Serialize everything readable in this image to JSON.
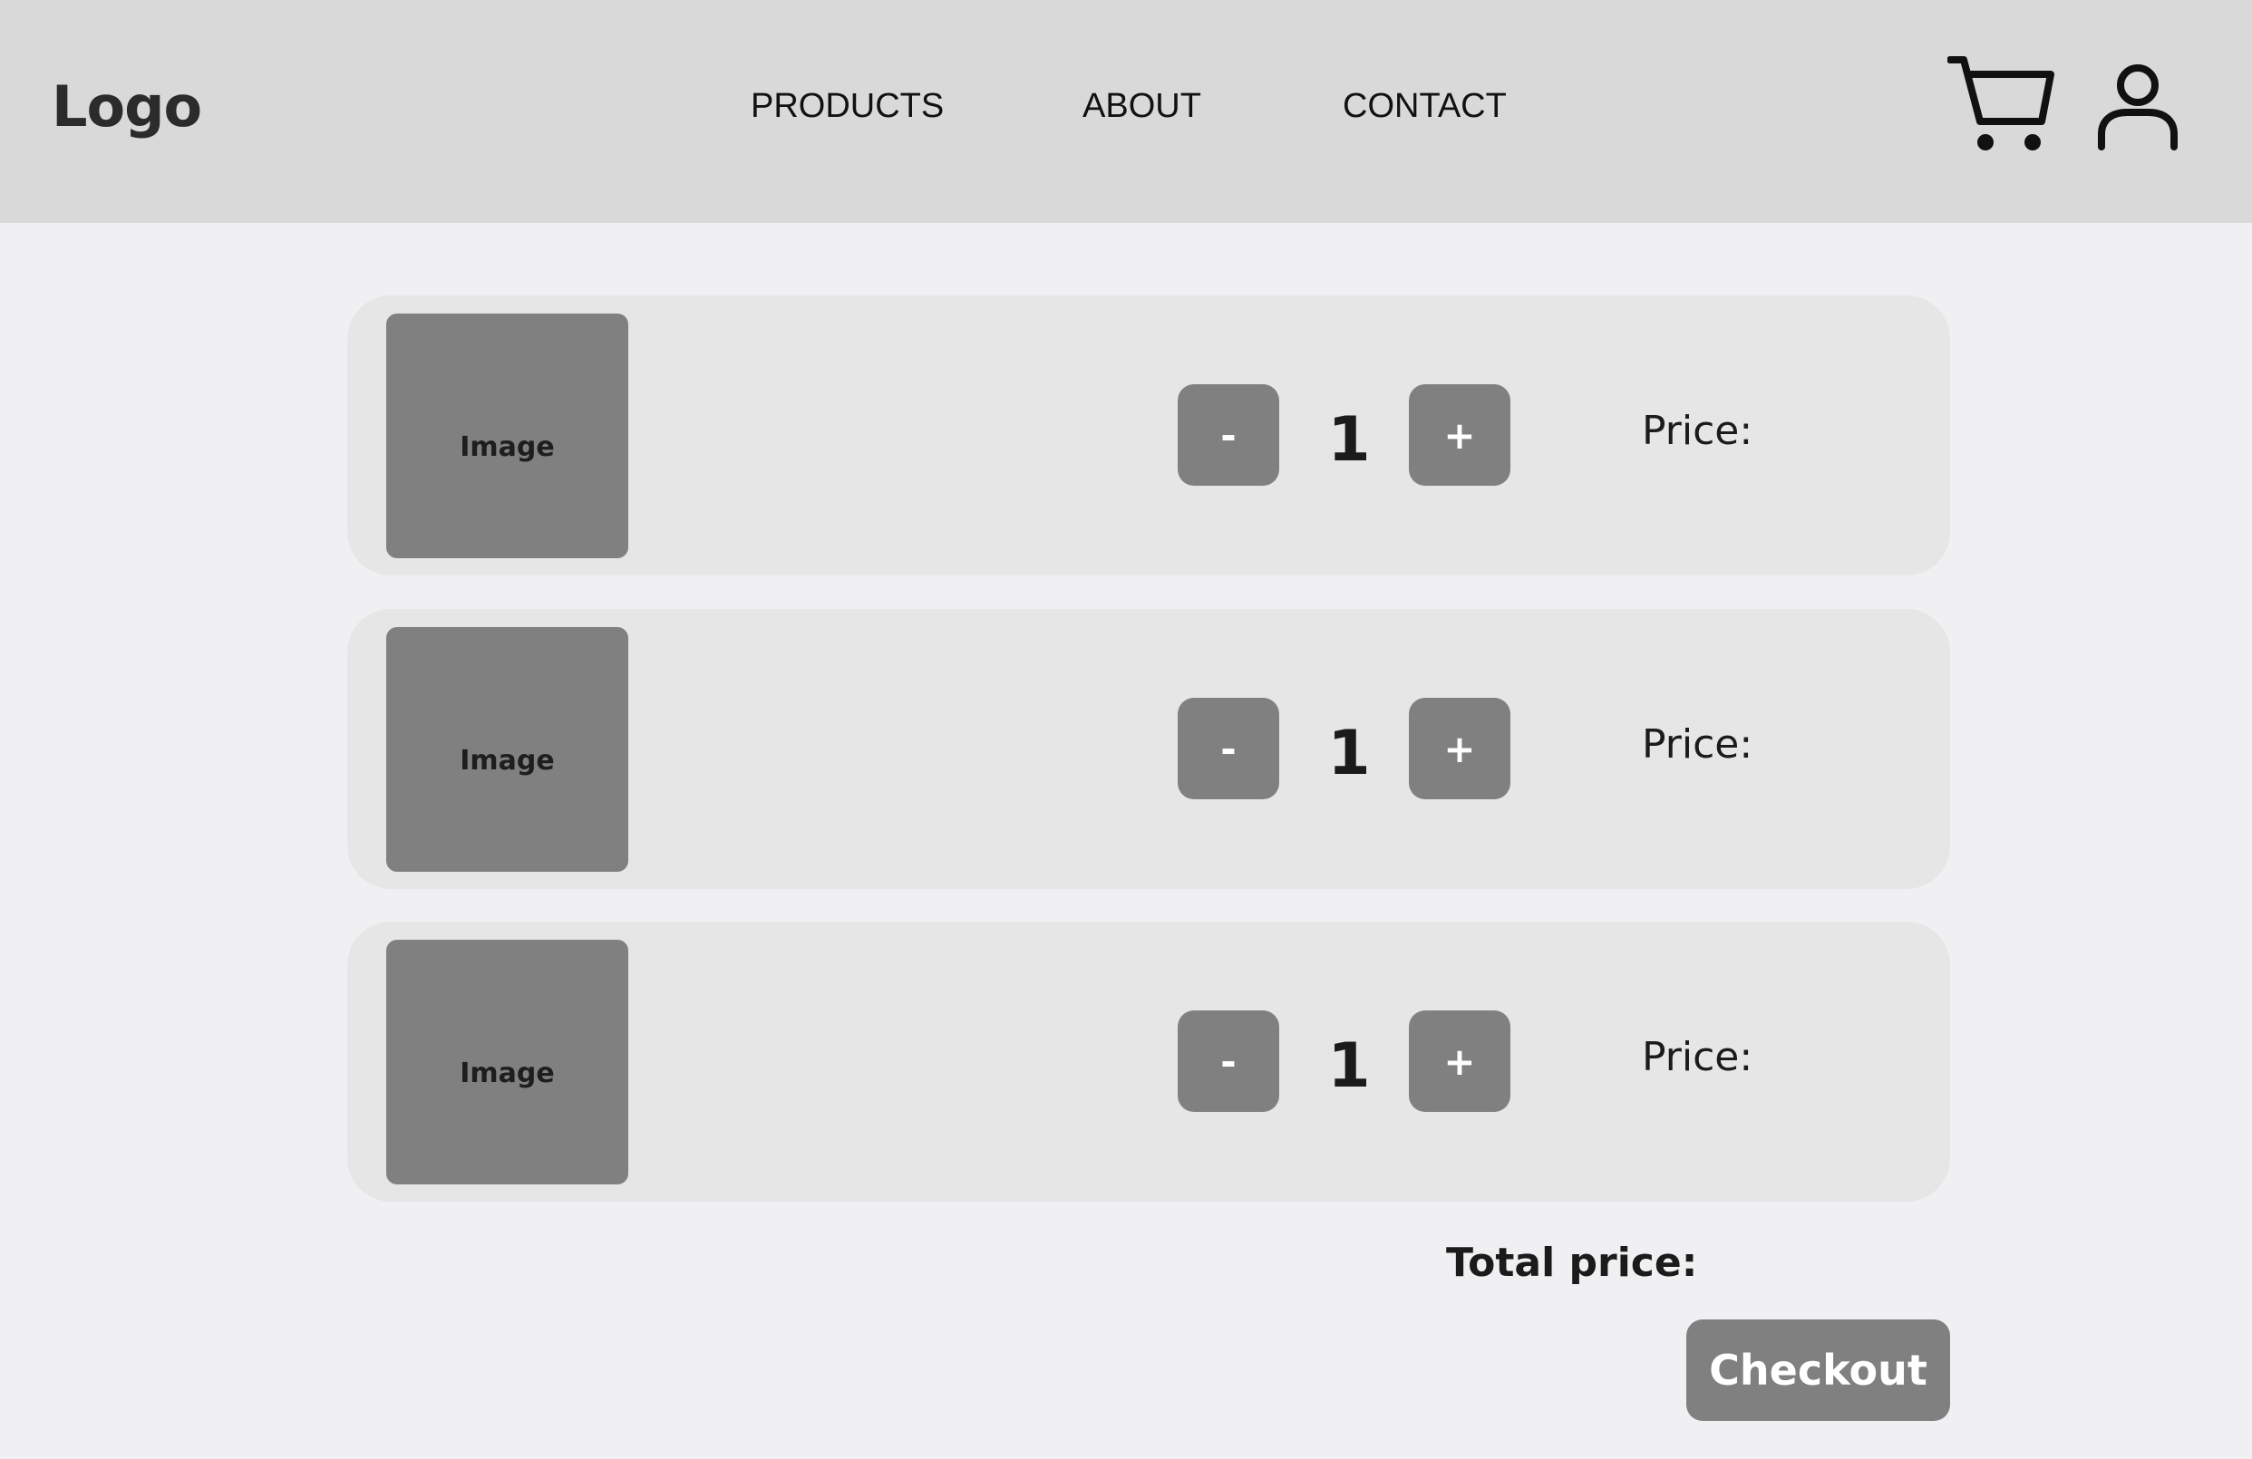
{
  "header": {
    "logo": "Logo",
    "nav": {
      "products": "PRODUCTS",
      "about": "ABOUT",
      "contact": "CONTACT"
    },
    "icons": [
      "cart-icon",
      "user-icon"
    ]
  },
  "cart": {
    "items": [
      {
        "image_label": "Image",
        "minus_label": "-",
        "quantity": "1",
        "plus_label": "+",
        "price_label": "Price:"
      },
      {
        "image_label": "Image",
        "minus_label": "-",
        "quantity": "1",
        "plus_label": "+",
        "price_label": "Price:"
      },
      {
        "image_label": "Image",
        "minus_label": "-",
        "quantity": "1",
        "plus_label": "+",
        "price_label": "Price:"
      }
    ],
    "total_label": "Total price:",
    "checkout_label": "Checkout"
  },
  "colors": {
    "header_bg": "#d9d9d9",
    "page_bg": "#f0f0f2",
    "card_bg": "#e6e6e6",
    "button_bg": "#808080"
  }
}
